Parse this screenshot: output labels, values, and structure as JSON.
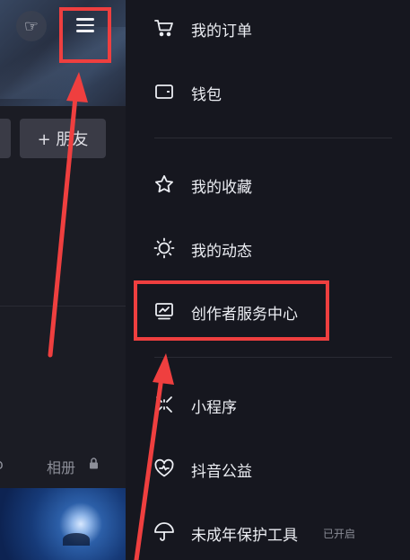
{
  "left": {
    "hand_icon": "pointing-hand-icon",
    "menu_icon": "hamburger-menu-icon",
    "add_friend_label": "+ 朋友",
    "album_label": "相册",
    "partial_text": "o"
  },
  "drawer": {
    "items": [
      {
        "label": "我的订单",
        "icon": "cart-icon"
      },
      {
        "label": "钱包",
        "icon": "wallet-icon"
      },
      {
        "label": "我的收藏",
        "icon": "star-icon"
      },
      {
        "label": "我的动态",
        "icon": "sun-icon"
      },
      {
        "label": "创作者服务中心",
        "icon": "chart-monitor-icon"
      },
      {
        "label": "小程序",
        "icon": "spark-icon"
      },
      {
        "label": "抖音公益",
        "icon": "heart-icon"
      },
      {
        "label": "未成年保护工具",
        "icon": "umbrella-icon",
        "badge": "已开启"
      }
    ]
  },
  "colors": {
    "annotation_red": "#ef3f3f",
    "drawer_bg": "#16171f",
    "text": "#eceef3"
  }
}
